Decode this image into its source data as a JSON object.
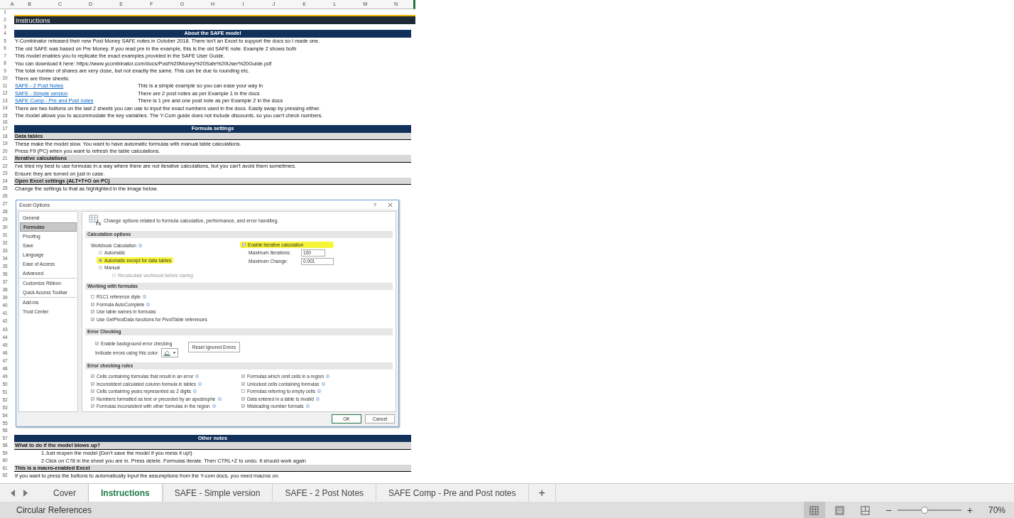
{
  "column_headers": [
    "A",
    "B",
    "C",
    "D",
    "E",
    "F",
    "G",
    "H",
    "I",
    "J",
    "K",
    "L",
    "M",
    "N"
  ],
  "rows": [
    {
      "row": "1",
      "kind": "spacer"
    },
    {
      "row": "2",
      "kind": "title",
      "text": "Instructions"
    },
    {
      "row": "3",
      "kind": "spacer"
    },
    {
      "row": "4",
      "kind": "section",
      "text": "About the SAFE model"
    },
    {
      "row": "5",
      "kind": "text",
      "text": "Y-Combinator released their new Post Money SAFE notes in October 2018. There isn't an Excel to support the docs so I made one."
    },
    {
      "row": "6",
      "kind": "text",
      "text": "The old SAFE was based on Pre Money. If you read pre in the example, this is the old SAFE note. Example 2 shows both"
    },
    {
      "row": "7",
      "kind": "text",
      "text": "This model enables you to replicate the exact examples provided in the SAFE User Guide."
    },
    {
      "row": "8",
      "kind": "text",
      "text": "You can download it here: https://www.ycombinator.com/docs/Post%20Money%20Safe%20User%20Guide.pdf"
    },
    {
      "row": "9",
      "kind": "text",
      "text": "The total number of shares are very close, but not exactly the same. This can be due to rounding etc."
    },
    {
      "row": "10",
      "kind": "text",
      "text": "There are three sheets:"
    },
    {
      "row": "11",
      "kind": "link",
      "link": "SAFE - 2 Post Notes",
      "text": "This is a simple example so you can ease your way in"
    },
    {
      "row": "12",
      "kind": "link",
      "link": "SAFE - Simple version",
      "text": "There are 2 post notes as per Example 1 in the docs"
    },
    {
      "row": "13",
      "kind": "link",
      "link": "SAFE Comp - Pre and Post notes",
      "text": "There is 1 pre and one post note as per Example 2 in the docs"
    },
    {
      "row": "14",
      "kind": "text",
      "text": "There are two buttons on the last 2 sheets you can use to input the exact numbers used in the docs. Easily swap by pressing either."
    },
    {
      "row": "15",
      "kind": "text",
      "text": "The model allows you to accommodate the key variables. The Y-Com guide does not include discounts, so you can't check numbers."
    },
    {
      "row": "16",
      "kind": "spacer"
    },
    {
      "row": "17",
      "kind": "section",
      "text": "Formula settings"
    },
    {
      "row": "18",
      "kind": "subheader",
      "text": "Data tables"
    },
    {
      "row": "19",
      "kind": "text",
      "text": "These make the model slow. You want to have automatic formulas with manual table calculations."
    },
    {
      "row": "20",
      "kind": "text",
      "text": "Press F9 (PC) when you want to refresh the table calculations."
    },
    {
      "row": "21",
      "kind": "subheader",
      "text": "Iterative calculations"
    },
    {
      "row": "22",
      "kind": "text",
      "text": "I've tried my best to use formulas in a way where there are not iterative calculations, but you can't avoid them sometimes."
    },
    {
      "row": "23",
      "kind": "text",
      "text": "Ensure they are turned on just in case."
    },
    {
      "row": "24",
      "kind": "subheader",
      "text": "Open Excel settings (ALT+T+O on PC)"
    },
    {
      "row": "25",
      "kind": "text",
      "text": "Change the settings to that as highlighted in the image below."
    },
    {
      "row": "26",
      "kind": "blank"
    },
    {
      "kind": "dialog",
      "row_numbers": [
        "27",
        "28",
        "29",
        "30",
        "31",
        "32",
        "33",
        "34",
        "35",
        "36",
        "37",
        "38",
        "39",
        "40",
        "41",
        "42",
        "43",
        "44",
        "45",
        "46",
        "47",
        "48",
        "49",
        "50",
        "51",
        "52",
        "53",
        "54",
        "55"
      ]
    },
    {
      "row": "56",
      "kind": "blank"
    },
    {
      "row": "57",
      "kind": "section",
      "text": "Other notes"
    },
    {
      "row": "58",
      "kind": "subheader",
      "text": "What to do if the model blows up?"
    },
    {
      "row": "59",
      "kind": "numbered",
      "number": "1",
      "text": "Just reopen the model (Don't save the model if you mess it up!)"
    },
    {
      "row": "60",
      "kind": "numbered",
      "number": "2",
      "text": "Click on C78 in the sheet you are in. Press delete. Formulas iterate. Then CTRL+Z to undo. It should work again"
    },
    {
      "row": "61",
      "kind": "subheader",
      "text": "This is a macro-enabled Excel"
    },
    {
      "row": "62",
      "kind": "text",
      "text": "If you want to press the buttons to automatically input the assumptions from the Y-com docs, you need macros on."
    }
  ],
  "excel_options": {
    "title": "Excel Options",
    "help": "?",
    "sidebar": [
      {
        "label": "General",
        "selected": false,
        "separator_after": false
      },
      {
        "label": "Formulas",
        "selected": true,
        "separator_after": false
      },
      {
        "label": "Proofing",
        "selected": false,
        "separator_after": false
      },
      {
        "label": "Save",
        "selected": false,
        "separator_after": false
      },
      {
        "label": "Language",
        "selected": false,
        "separator_after": false
      },
      {
        "label": "Ease of Access",
        "selected": false,
        "separator_after": false
      },
      {
        "label": "Advanced",
        "selected": false,
        "separator_after": true
      },
      {
        "label": "Customize Ribbon",
        "selected": false,
        "separator_after": false
      },
      {
        "label": "Quick Access Toolbar",
        "selected": false,
        "separator_after": true
      },
      {
        "label": "Add-ins",
        "selected": false,
        "separator_after": false
      },
      {
        "label": "Trust Center",
        "selected": false,
        "separator_after": false
      }
    ],
    "intro": "Change options related to formula calculation, performance, and error handling.",
    "calculation": {
      "heading": "Calculation options",
      "workbook_label": "Workbook Calculation",
      "modes": [
        {
          "label": "Automatic",
          "selected": false,
          "highlighted": false
        },
        {
          "label": "Automatic except for data tables",
          "selected": true,
          "highlighted": true
        },
        {
          "label": "Manual",
          "selected": false,
          "highlighted": false
        }
      ],
      "recalculate": {
        "label": "Recalculate workbook before saving",
        "checked": true,
        "disabled": true
      },
      "iterative": {
        "label": "Enable iterative calculation",
        "checked": true,
        "highlighted": true
      },
      "max_iterations": {
        "label": "Maximum Iterations:",
        "value": "100"
      },
      "max_change": {
        "label": "Maximum Change:",
        "value": "0.001"
      }
    },
    "working": {
      "heading": "Working with formulas",
      "options": [
        {
          "label": "R1C1 reference style",
          "checked": false,
          "info": true
        },
        {
          "label": "Formula AutoComplete",
          "checked": true,
          "info": true
        },
        {
          "label": "Use table names in formulas",
          "checked": true,
          "info": false
        },
        {
          "label": "Use GetPivotData functions for PivotTable references",
          "checked": true,
          "info": false
        }
      ]
    },
    "error_checking": {
      "heading": "Error Checking",
      "enable": {
        "label": "Enable background error checking",
        "checked": true
      },
      "color_label": "Indicate errors using this color:",
      "reset_button": "Reset Ignored Errors"
    },
    "rules": {
      "heading": "Error checking rules",
      "left": [
        {
          "label": "Cells containing formulas that result in an error",
          "checked": true,
          "info": true
        },
        {
          "label": "Inconsistent calculated column formula in tables",
          "checked": true,
          "info": true
        },
        {
          "label": "Cells containing years represented as 2 digits",
          "checked": true,
          "info": true
        },
        {
          "label": "Numbers formatted as text or preceded by an apostrophe",
          "checked": true,
          "info": true
        },
        {
          "label": "Formulas inconsistent with other formulas in the region",
          "checked": true,
          "info": true
        }
      ],
      "right": [
        {
          "label": "Formulas which omit cells in a region",
          "checked": true,
          "info": true
        },
        {
          "label": "Unlocked cells containing formulas",
          "checked": true,
          "info": true
        },
        {
          "label": "Formulas referring to empty cells",
          "checked": false,
          "info": true
        },
        {
          "label": "Data entered in a table is invalid",
          "checked": true,
          "info": true
        },
        {
          "label": "Misleading number formats",
          "checked": true,
          "info": true
        }
      ]
    },
    "buttons": [
      {
        "label": "OK",
        "default": true
      },
      {
        "label": "Cancel",
        "default": false
      }
    ]
  },
  "sheet_tabs": [
    {
      "label": "Cover",
      "selected": false
    },
    {
      "label": "Instructions",
      "selected": true
    },
    {
      "label": "SAFE - Simple version",
      "selected": false
    },
    {
      "label": "SAFE - 2 Post Notes",
      "selected": false
    },
    {
      "label": "SAFE Comp - Pre and Post notes",
      "selected": false
    }
  ],
  "add_sheet": "+",
  "status_bar": {
    "text": "Circular References",
    "views": [
      {
        "kind": "normal",
        "selected": true
      },
      {
        "kind": "page_layout",
        "selected": false
      },
      {
        "kind": "page_break",
        "selected": false
      }
    ],
    "zoom": {
      "minus": "−",
      "plus": "+",
      "level": 0.42,
      "reading": "70%"
    }
  }
}
